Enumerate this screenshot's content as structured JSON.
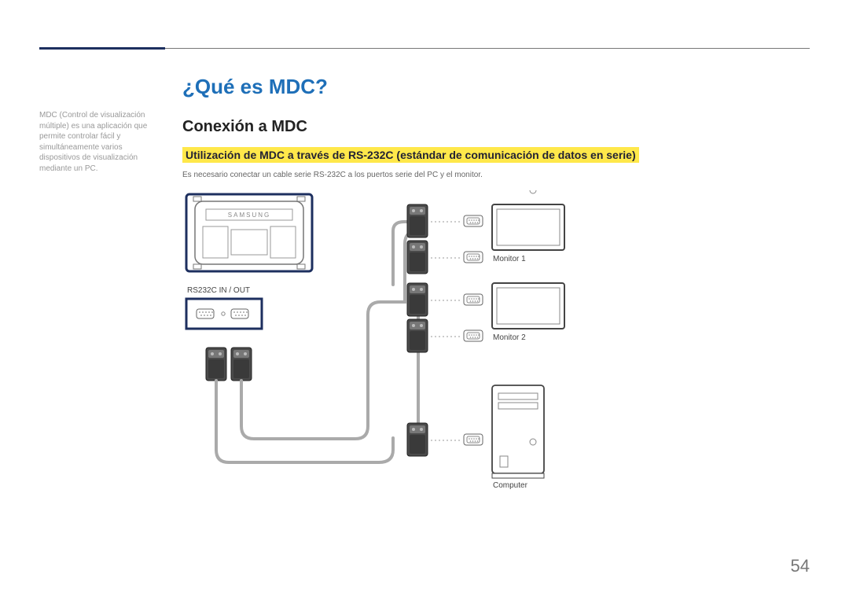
{
  "page_number": "54",
  "sidebar_note": "MDC (Control de visualización múltiple) es una aplicación que permite controlar fácil y simultáneamente varios dispositivos de visualización mediante un PC.",
  "title": "¿Qué es MDC?",
  "subtitle": "Conexión a MDC",
  "highlight": "Utilización de MDC a través de RS-232C (estándar de comunicación de datos en serie)",
  "body": "Es necesario conectar un cable serie RS-232C a los puertos serie del PC y el monitor.",
  "labels": {
    "rs232c": "RS232C IN / OUT",
    "monitor1": "Monitor 1",
    "monitor2": "Monitor 2",
    "computer": "Computer",
    "brand": "SAMSUNG"
  }
}
